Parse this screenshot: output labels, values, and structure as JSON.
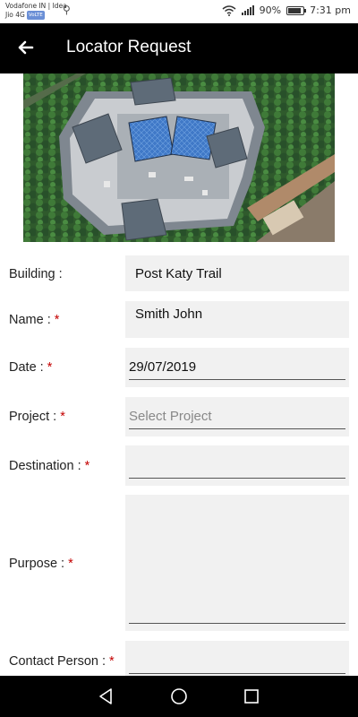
{
  "status_bar": {
    "carrier_1": "Vodafone IN | Idea",
    "carrier_2": "Jio 4G",
    "volte_badge": "VoLTE",
    "battery_percent": "90%",
    "battery_level": 0.9,
    "time": "7:31 pm"
  },
  "app_bar": {
    "title": "Locator Request",
    "back_icon": "arrow-left-icon"
  },
  "hero_image": {
    "description_icon": "aerial-building-photo"
  },
  "form": {
    "building": {
      "label": "Building :",
      "value": "Post Katy Trail",
      "required": false
    },
    "name": {
      "label": "Name :",
      "value": "Smith John",
      "required": true
    },
    "date": {
      "label": "Date :",
      "value": "29/07/2019",
      "required": true
    },
    "project": {
      "label": "Project :",
      "placeholder": "Select Project",
      "required": true
    },
    "destination": {
      "label": "Destination :",
      "value": "",
      "required": true
    },
    "purpose": {
      "label": "Purpose :",
      "value": "",
      "required": true
    },
    "contact_person": {
      "label": "Contact Person :",
      "value": "",
      "required": true
    },
    "required_marker": "*"
  },
  "colors": {
    "app_bar": "#000000",
    "required": "#c40000",
    "field_background": "#f1f1f1"
  }
}
